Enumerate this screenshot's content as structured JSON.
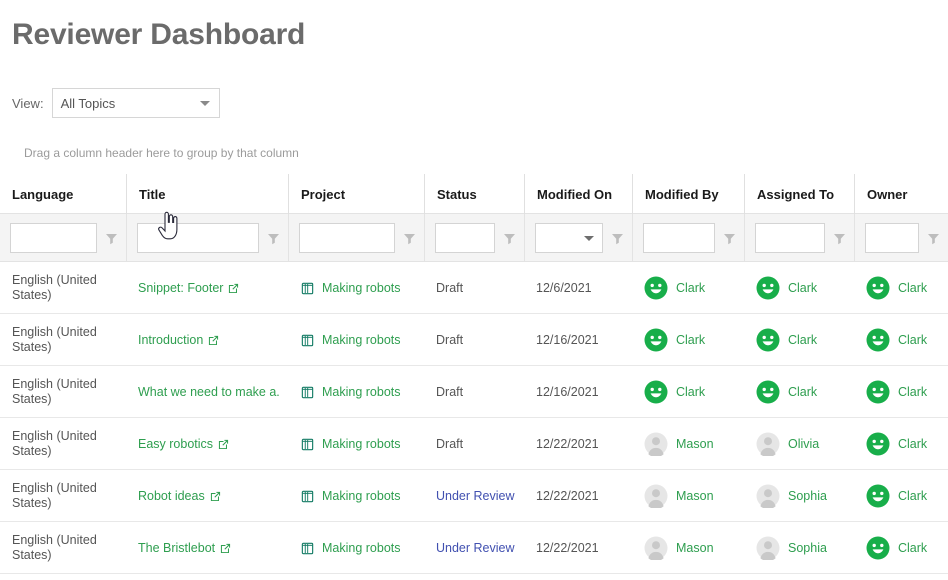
{
  "header": {
    "title": "Reviewer Dashboard"
  },
  "toolbar": {
    "view_label": "View:",
    "view_value": "All Topics",
    "view_options": [
      "All Topics"
    ]
  },
  "grid": {
    "group_hint": "Drag a column header here to group by that column",
    "columns": [
      {
        "key": "language",
        "label": "Language",
        "filter": "text"
      },
      {
        "key": "title",
        "label": "Title",
        "filter": "text"
      },
      {
        "key": "project",
        "label": "Project",
        "filter": "text"
      },
      {
        "key": "status",
        "label": "Status",
        "filter": "text"
      },
      {
        "key": "modified_on",
        "label": "Modified On",
        "filter": "dropdown"
      },
      {
        "key": "modified_by",
        "label": "Modified By",
        "filter": "text"
      },
      {
        "key": "assigned_to",
        "label": "Assigned To",
        "filter": "text"
      },
      {
        "key": "owner",
        "label": "Owner",
        "filter": "text"
      }
    ],
    "filter_values": [
      "",
      "",
      "",
      "",
      "",
      "",
      "",
      ""
    ],
    "rows": [
      {
        "language": "English (United States)",
        "title": "Snippet: Footer",
        "project": "Making robots",
        "status": "Draft",
        "modified_on": "12/6/2021",
        "modified_by": "Clark",
        "modified_by_avatar": "smiley-green",
        "assigned_to": "Clark",
        "assigned_to_avatar": "smiley-green",
        "owner": "Clark",
        "owner_avatar": "smiley-green"
      },
      {
        "language": "English (United States)",
        "title": "Introduction",
        "project": "Making robots",
        "status": "Draft",
        "modified_on": "12/16/2021",
        "modified_by": "Clark",
        "modified_by_avatar": "smiley-green",
        "assigned_to": "Clark",
        "assigned_to_avatar": "smiley-green",
        "owner": "Clark",
        "owner_avatar": "smiley-green"
      },
      {
        "language": "English (United States)",
        "title": "What we need to make a...",
        "project": "Making robots",
        "status": "Draft",
        "modified_on": "12/16/2021",
        "modified_by": "Clark",
        "modified_by_avatar": "smiley-green",
        "assigned_to": "Clark",
        "assigned_to_avatar": "smiley-green",
        "owner": "Clark",
        "owner_avatar": "smiley-green"
      },
      {
        "language": "English (United States)",
        "title": "Easy robotics",
        "project": "Making robots",
        "status": "Draft",
        "modified_on": "12/22/2021",
        "modified_by": "Mason",
        "modified_by_avatar": "person-gray",
        "assigned_to": "Olivia",
        "assigned_to_avatar": "person-gray",
        "owner": "Clark",
        "owner_avatar": "smiley-green"
      },
      {
        "language": "English (United States)",
        "title": "Robot ideas",
        "project": "Making robots",
        "status": "Under Review",
        "modified_on": "12/22/2021",
        "modified_by": "Mason",
        "modified_by_avatar": "person-gray",
        "assigned_to": "Sophia",
        "assigned_to_avatar": "person-gray",
        "owner": "Clark",
        "owner_avatar": "smiley-green"
      },
      {
        "language": "English (United States)",
        "title": "The Bristlebot",
        "project": "Making robots",
        "status": "Under Review",
        "modified_on": "12/22/2021",
        "modified_by": "Mason",
        "modified_by_avatar": "person-gray",
        "assigned_to": "Sophia",
        "assigned_to_avatar": "person-gray",
        "owner": "Clark",
        "owner_avatar": "smiley-green"
      }
    ]
  },
  "icons": {
    "title_link": "external-link-icon",
    "project": "book-stack-icon",
    "filter": "funnel-icon",
    "dropdown": "chevron-down-icon",
    "cursor": "pointer-hand-cursor"
  },
  "colors": {
    "link_green": "#2e9e4f",
    "status_review": "#4150b0",
    "text_gray": "#555555",
    "title_gray": "#6b6b6b",
    "avatar_green": "#18ae4a",
    "avatar_gray": "#d0d0d0",
    "filter_bg": "#f4f4f4",
    "border": "#e3e3e3"
  }
}
